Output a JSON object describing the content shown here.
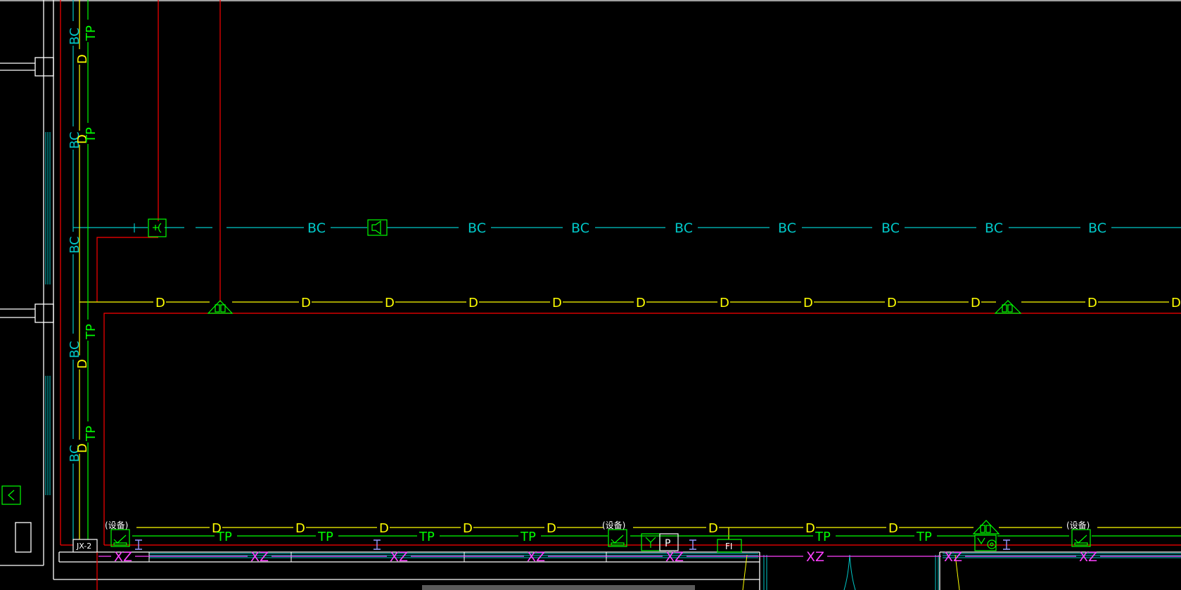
{
  "colors": {
    "background": "#000000",
    "wall": "#ffffff",
    "bc_line": "#00c8c8",
    "d_line": "#ffff00",
    "tp_line": "#00ff00",
    "xz_line": "#ff40ff",
    "power_line": "#ff0000",
    "device": "#00ff00"
  },
  "labels": {
    "bc": "BC",
    "d": "D",
    "tp": "TP",
    "xz": "XZ",
    "junction_box": "JX-2",
    "p_box": "P",
    "fi_box": "FI",
    "device_tag": "(设备)"
  },
  "icons": [
    "camera-icon",
    "speaker-icon",
    "dome-camera-icon",
    "tv-outlet-icon",
    "antenna-outlet-icon",
    "cross-box-icon"
  ]
}
